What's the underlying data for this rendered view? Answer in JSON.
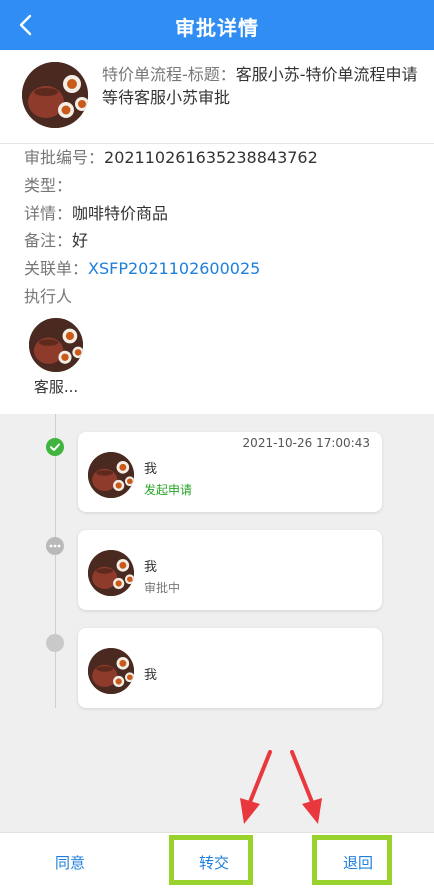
{
  "header": {
    "title": "审批详情",
    "back_icon": "back-chevron-icon"
  },
  "summary": {
    "flow_label": "特价单流程-标题：",
    "flow_title": "客服小苏-特价单流程申请",
    "waiting": "等待客服小苏审批"
  },
  "details": {
    "number_label": "审批编号：",
    "number_value": "20211026163523884376​2",
    "type_label": "类型：",
    "type_value": "",
    "detail_label": "详情：",
    "detail_value": "咖啡特价商品",
    "remark_label": "备注：",
    "remark_value": "好",
    "link_label": "关联单：",
    "link_value": "XSFP2021102600025",
    "executor_label": "执行人",
    "executor_name": "客服..."
  },
  "timeline": [
    {
      "time": "2021-10-26 17:00:43",
      "who": "我",
      "status": "发起申请",
      "status_color": "#27a327",
      "dot": "check-icon"
    },
    {
      "time": "",
      "who": "我",
      "status": "审批中",
      "status_color": "#777777",
      "dot": "more-dots-icon"
    },
    {
      "time": "",
      "who": "我",
      "status": "",
      "status_color": "#777777",
      "dot": "circle-icon"
    }
  ],
  "actions": {
    "agree": "同意",
    "transfer": "转交",
    "return": "退回"
  },
  "colors": {
    "header": "#2f8df3",
    "link": "#1d7fdc",
    "success": "#3fb53f",
    "highlight": "#99d22c",
    "arrow": "#e8383d"
  }
}
